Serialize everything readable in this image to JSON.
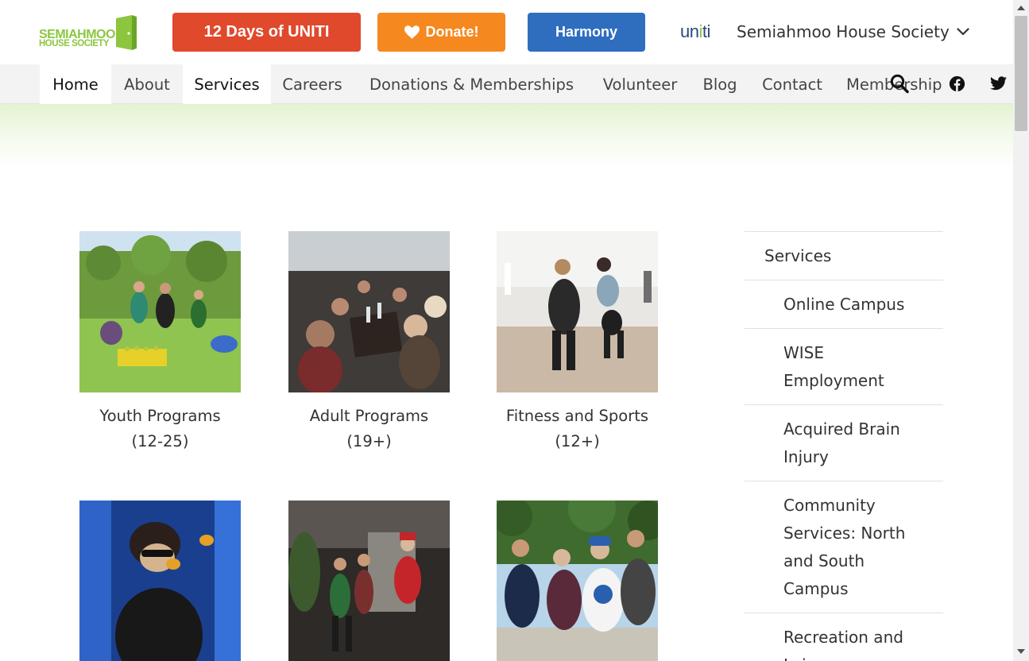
{
  "header": {
    "logo_line1": "SEMIAHMOO",
    "logo_line2": "HOUSE SOCIETY",
    "buttons": {
      "uniti": "12 Days of UNITI",
      "donate": "Donate!",
      "harmony": "Harmony"
    },
    "uniti_logo": {
      "left": "un",
      "accent": "i",
      "right": "ti"
    },
    "org_selector": "Semiahmoo House Society"
  },
  "nav": {
    "items": [
      "Home",
      "About",
      "Services",
      "Careers",
      "Donations & Memberships",
      "Volunteer",
      "Blog",
      "Contact",
      "Membership"
    ],
    "icons": [
      "search-icon",
      "facebook-icon",
      "twitter-icon"
    ]
  },
  "programs": [
    {
      "title": "Youth Programs",
      "sub": "(12-25)"
    },
    {
      "title": "Adult Programs",
      "sub": "(19+)"
    },
    {
      "title": "Fitness and Sports",
      "sub": "(12+)"
    },
    {
      "title": "",
      "sub": ""
    },
    {
      "title": "",
      "sub": ""
    },
    {
      "title": "",
      "sub": ""
    }
  ],
  "sidebar": {
    "heading": "Services",
    "items": [
      "Online Campus",
      "WISE Employment",
      "Acquired Brain Injury",
      "Community Services: North and South Campus",
      "Recreation and Leisure"
    ]
  },
  "colors": {
    "brand_green": "#8cc63f",
    "uniti_red": "#e0492c",
    "donate_orange": "#f5891f",
    "harmony_blue": "#2f6dbf"
  }
}
